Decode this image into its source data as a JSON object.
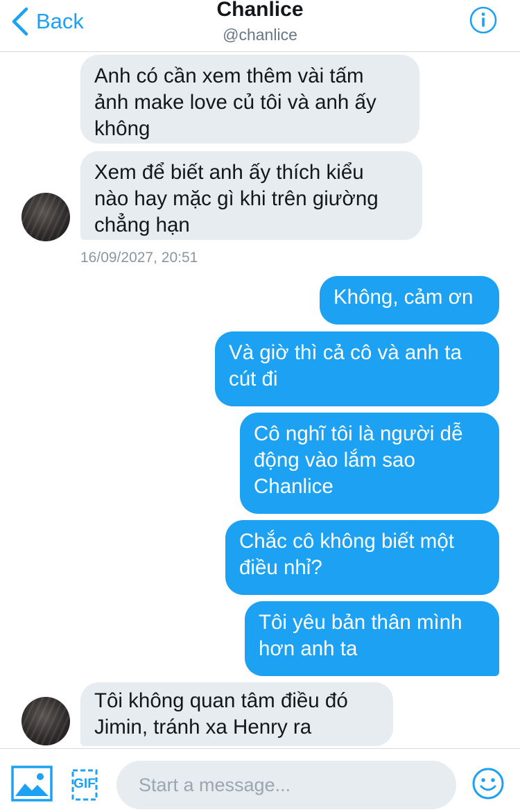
{
  "header": {
    "back_label": "Back",
    "title": "Chanlice",
    "handle": "@chanlice"
  },
  "messages": [
    {
      "side": "in",
      "text": "Anh có cần xem thêm vài tấm\nảnh make love củ tôi và anh ấy\nkhông"
    },
    {
      "side": "in",
      "text": "Xem để biết anh ấy thích kiểu\nnào hay mặc gì khi trên giường\nchẳng hạn"
    },
    {
      "side": "out",
      "text": "Không, cảm ơn"
    },
    {
      "side": "out",
      "text": "Và giờ thì cả cô và anh ta\ncút đi"
    },
    {
      "side": "out",
      "text": "Cô nghĩ tôi là người dễ\nđộng vào lắm sao\nChanlice"
    },
    {
      "side": "out",
      "text": "Chắc cô không biết một\nđiều nhỉ?"
    },
    {
      "side": "out",
      "text": "Tôi yêu bản thân mình\nhơn anh ta"
    },
    {
      "side": "in",
      "text": "Tôi không quan tâm điều đó\nJimin, tránh xa Henry ra"
    }
  ],
  "timestamp": "16/09/2027, 20:51",
  "composer": {
    "placeholder": "Start a message...",
    "gif_label": "GIF"
  },
  "colors": {
    "accent": "#1da1f2",
    "incoming_bubble": "#e6ecf0",
    "outgoing_bubble": "#1da1f2",
    "muted_text": "#657786"
  },
  "icons": [
    "chevron-left-icon",
    "info-icon",
    "image-icon",
    "gif-icon",
    "emoji-icon"
  ]
}
